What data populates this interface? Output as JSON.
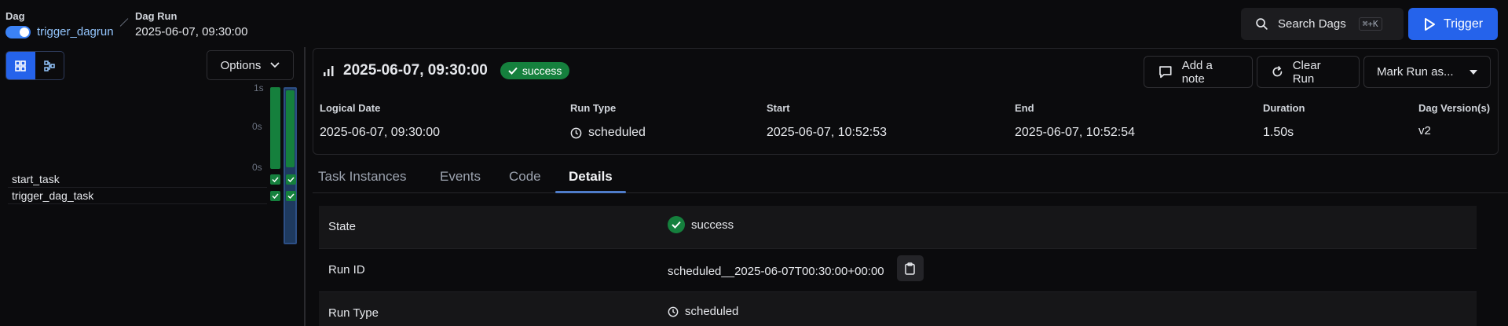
{
  "breadcrumb": {
    "dag_label": "Dag",
    "dag_name": "trigger_dagrun",
    "run_label": "Dag Run",
    "run_value": "2025-06-07, 09:30:00"
  },
  "search": {
    "label": "Search Dags",
    "shortcut": "⌘+K"
  },
  "trigger": {
    "label": "Trigger"
  },
  "left": {
    "options_label": "Options",
    "axis": [
      "1s",
      "0s",
      "0s"
    ],
    "tasks": [
      "start_task",
      "trigger_dag_task"
    ]
  },
  "run": {
    "title": "2025-06-07, 09:30:00",
    "state": "success",
    "add_note": "Add a note",
    "clear_run": "Clear Run",
    "mark_run": "Mark Run as...",
    "meta": [
      {
        "label": "Logical Date",
        "value": "2025-06-07, 09:30:00"
      },
      {
        "label": "Run Type",
        "value": "scheduled"
      },
      {
        "label": "Start",
        "value": "2025-06-07, 10:52:53"
      },
      {
        "label": "End",
        "value": "2025-06-07, 10:52:54"
      },
      {
        "label": "Duration",
        "value": "1.50s"
      },
      {
        "label": "Dag Version(s)",
        "value": "v2"
      }
    ]
  },
  "tabs": [
    "Task Instances",
    "Events",
    "Code",
    "Details"
  ],
  "details": [
    {
      "key": "State",
      "value": "success"
    },
    {
      "key": "Run ID",
      "value": "scheduled__2025-06-07T00:30:00+00:00"
    },
    {
      "key": "Run Type",
      "value": "scheduled"
    }
  ],
  "colors": {
    "accent": "#2563eb",
    "success": "#15803d"
  }
}
